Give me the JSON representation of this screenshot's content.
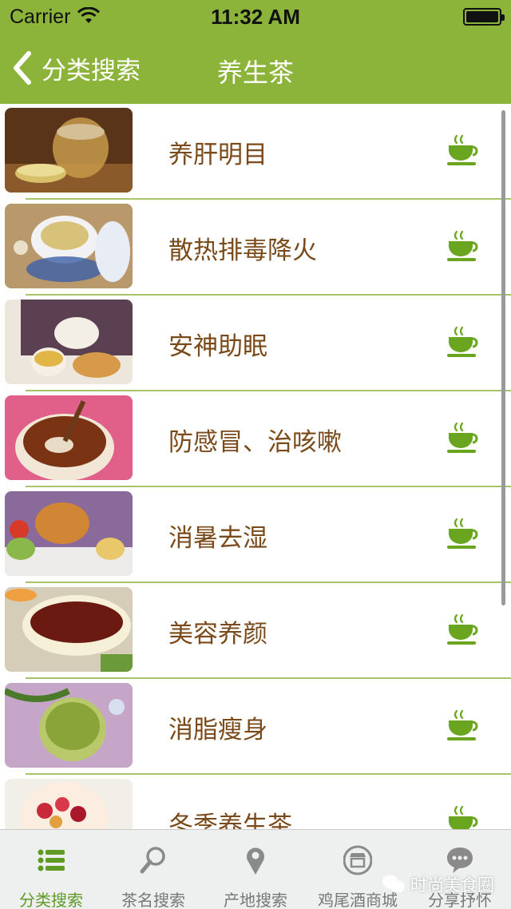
{
  "status": {
    "carrier": "Carrier",
    "time": "11:32 AM"
  },
  "nav": {
    "back_label": "分类搜索",
    "title": "养生茶"
  },
  "items": [
    {
      "label": "养肝明目"
    },
    {
      "label": "散热排毒降火"
    },
    {
      "label": "安神助眠"
    },
    {
      "label": "防感冒、治咳嗽"
    },
    {
      "label": "消暑去湿"
    },
    {
      "label": "美容养颜"
    },
    {
      "label": "消脂瘦身"
    },
    {
      "label": "冬季养生茶"
    }
  ],
  "tabs": [
    {
      "label": "分类搜索",
      "icon": "list-icon",
      "active": true
    },
    {
      "label": "茶名搜索",
      "icon": "magnifier-icon",
      "active": false
    },
    {
      "label": "产地搜索",
      "icon": "location-pin-icon",
      "active": false
    },
    {
      "label": "鸡尾酒商城",
      "icon": "store-icon",
      "active": false
    },
    {
      "label": "分享抒怀",
      "icon": "chat-bubble-icon",
      "active": false
    }
  ],
  "watermark": {
    "text": "时尚美食圈"
  },
  "colors": {
    "nav_green": "#8db43a",
    "label_brown": "#7a4a1a",
    "tab_active": "#5f9a25",
    "cup_green": "#6aa51f"
  }
}
